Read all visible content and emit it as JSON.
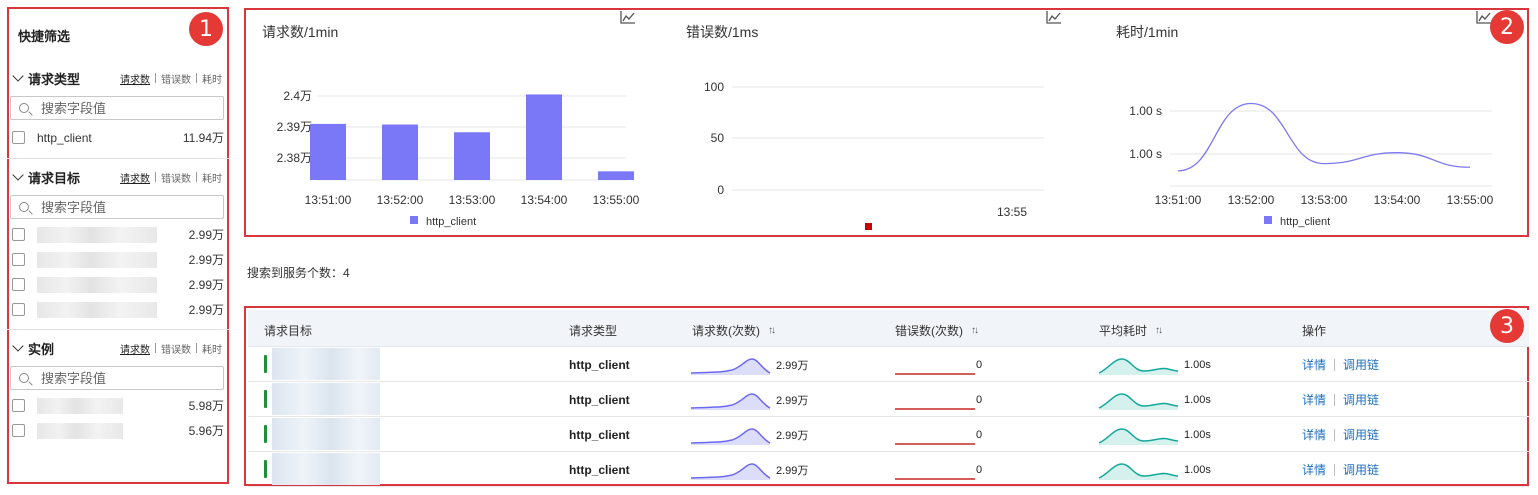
{
  "badges": [
    "1",
    "2",
    "3"
  ],
  "sidebar": {
    "title": "快捷筛选",
    "sections": [
      {
        "name": "请求类型",
        "tabs": [
          "请求数",
          "错误数",
          "耗时"
        ],
        "search_placeholder": "搜索字段值",
        "items": [
          {
            "label": "http_client",
            "value": "11.94万"
          }
        ]
      },
      {
        "name": "请求目标",
        "tabs": [
          "请求数",
          "错误数",
          "耗时"
        ],
        "search_placeholder": "搜索字段值",
        "items": [
          {
            "label": "",
            "value": "2.99万"
          },
          {
            "label": "",
            "value": "2.99万"
          },
          {
            "label": "",
            "value": "2.99万"
          },
          {
            "label": "",
            "value": "2.99万"
          }
        ]
      },
      {
        "name": "实例",
        "tabs": [
          "请求数",
          "错误数",
          "耗时"
        ],
        "search_placeholder": "搜索字段值",
        "items": [
          {
            "label": "",
            "value": "5.98万"
          },
          {
            "label": "",
            "value": "5.96万"
          }
        ]
      }
    ]
  },
  "chart_data": [
    {
      "type": "bar",
      "title": "请求数/1min",
      "icon": "line-chart-icon",
      "categories": [
        "13:51:00",
        "13:52:00",
        "13:53:00",
        "13:54:00",
        "13:55:00"
      ],
      "series": [
        {
          "name": "http_client",
          "values": [
            23910,
            23908,
            23883,
            24005,
            23757
          ],
          "color": "#7b78f7"
        }
      ],
      "yticks": [
        "2.4万",
        "2.39万",
        "2.38万"
      ],
      "legend": "bottom"
    },
    {
      "type": "line",
      "title": "错误数/1ms",
      "icon": "line-chart-icon",
      "yticks": [
        "100",
        "50",
        "0"
      ],
      "xticks": [
        "13:55"
      ],
      "series": [
        {
          "name": "",
          "values": [],
          "color": "#cc0000"
        }
      ],
      "legend": "bottom"
    },
    {
      "type": "line",
      "title": "耗时/1min",
      "icon": "line-chart-icon",
      "categories": [
        "13:51:00",
        "13:52:00",
        "13:53:00",
        "13:54:00",
        "13:55:00"
      ],
      "yticks": [
        "1.00 s",
        "1.00 s"
      ],
      "series": [
        {
          "name": "http_client",
          "values": [
            0.9995,
            1.0032,
            0.9999,
            1.0005,
            0.9997
          ],
          "color": "#7b78f7"
        }
      ],
      "legend": "bottom"
    }
  ],
  "info": "搜索到服务个数：4",
  "table": {
    "headers": [
      "请求目标",
      "请求类型",
      "请求数(次数)",
      "错误数(次数)",
      "平均耗时",
      "操作"
    ],
    "sort_glyph": "↑↓",
    "rows": [
      {
        "type": "http_client",
        "requests": "2.99万",
        "errors": "0",
        "avg": "1.00s",
        "actions": [
          "详情",
          "调用链"
        ]
      },
      {
        "type": "http_client",
        "requests": "2.99万",
        "errors": "0",
        "avg": "1.00s",
        "actions": [
          "详情",
          "调用链"
        ]
      },
      {
        "type": "http_client",
        "requests": "2.99万",
        "errors": "0",
        "avg": "1.00s",
        "actions": [
          "详情",
          "调用链"
        ]
      },
      {
        "type": "http_client",
        "requests": "2.99万",
        "errors": "0",
        "avg": "1.00s",
        "actions": [
          "详情",
          "调用链"
        ]
      }
    ]
  }
}
